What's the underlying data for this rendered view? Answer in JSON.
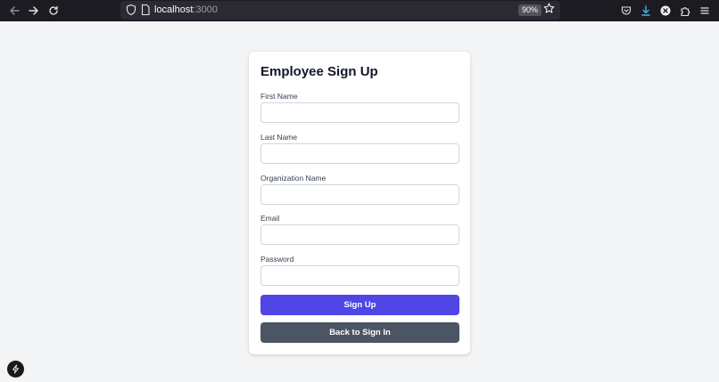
{
  "browser": {
    "url_host": "localhost",
    "url_port": ":3000",
    "zoom": "90%"
  },
  "form": {
    "title": "Employee Sign Up",
    "fields": [
      {
        "label": "First Name",
        "value": ""
      },
      {
        "label": "Last Name",
        "value": ""
      },
      {
        "label": "Organization Name",
        "value": ""
      },
      {
        "label": "Email",
        "value": ""
      },
      {
        "label": "Password",
        "value": ""
      }
    ],
    "submit_label": "Sign Up",
    "back_label": "Back to Sign In"
  },
  "colors": {
    "primary": "#4f46e5",
    "secondary": "#4b5563",
    "background": "#f3f4f6"
  }
}
